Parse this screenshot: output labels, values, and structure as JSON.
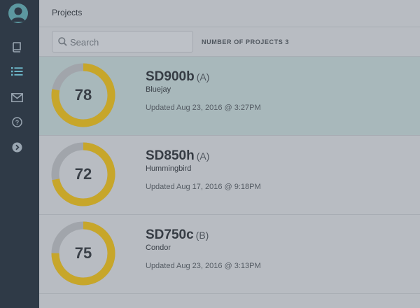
{
  "header": {
    "title": "Projects"
  },
  "search": {
    "placeholder": "Search",
    "value": ""
  },
  "summary": {
    "label": "NUMBER OF PROJECTS",
    "count": "3"
  },
  "sidebar": {
    "items": [
      {
        "name": "avatar",
        "icon": "user-avatar-icon"
      },
      {
        "name": "book",
        "icon": "book-icon"
      },
      {
        "name": "list",
        "icon": "list-icon",
        "active": true
      },
      {
        "name": "mail",
        "icon": "envelope-icon"
      },
      {
        "name": "help",
        "icon": "question-circle-icon"
      },
      {
        "name": "next",
        "icon": "chevron-right-circle-icon"
      }
    ]
  },
  "colors": {
    "gauge_fill": "#c7a62a",
    "gauge_track": "#a1a5ab",
    "active_nav": "#6cb7c9",
    "selected_row": "#a8b8bb"
  },
  "projects": [
    {
      "name": "SD900b",
      "grade": "(A)",
      "codename": "Bluejay",
      "score": 78,
      "updated": "Updated Aug 23, 2016 @ 3:27PM",
      "selected": true
    },
    {
      "name": "SD850h",
      "grade": "(A)",
      "codename": "Hummingbird",
      "score": 72,
      "updated": "Updated Aug 17, 2016 @ 9:18PM",
      "selected": false
    },
    {
      "name": "SD750c",
      "grade": "(B)",
      "codename": "Condor",
      "score": 75,
      "updated": "Updated Aug 23, 2016 @ 3:13PM",
      "selected": false
    }
  ]
}
